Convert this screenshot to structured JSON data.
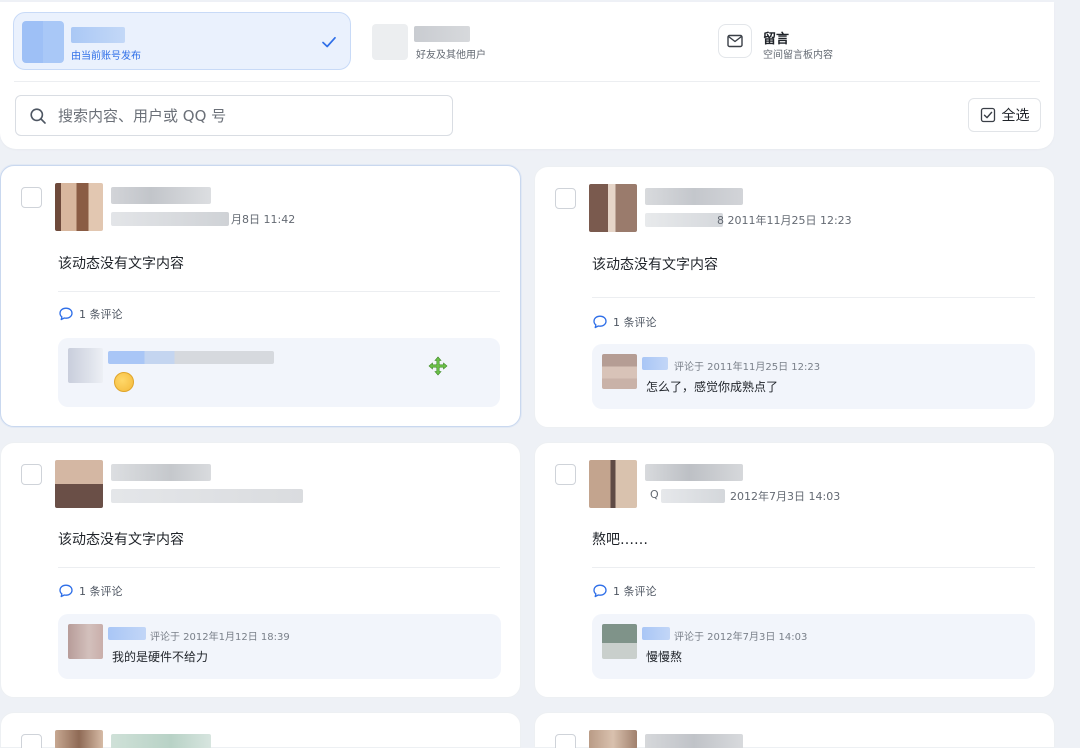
{
  "filters": {
    "mine": {
      "subtitle": "由当前账号发布"
    },
    "friends": {
      "subtitle": "好友及其他用户"
    },
    "guestbook": {
      "title": "留言",
      "subtitle": "空间留言板内容"
    }
  },
  "search": {
    "placeholder": "搜索内容、用户或 QQ 号",
    "value": ""
  },
  "toolbar": {
    "select_all_label": "全选"
  },
  "colors": {
    "accent": "#2f6fe8",
    "active_tab_bg": "#eaf1fd",
    "comment_bg": "#f2f5fb"
  },
  "posts": [
    {
      "date_fragment": "月8日 11:42",
      "text": "该动态没有文字内容",
      "comment_count": "1 条评论",
      "comment": {
        "emoji": "yawning-face"
      }
    },
    {
      "date_fragment": "8  2011年11月25日 12:23",
      "text": "该动态没有文字内容",
      "comment_count": "1 条评论",
      "comment": {
        "meta": "评论于  2011年11月25日 12:23",
        "text": "怎么了，感觉你成熟点了"
      }
    },
    {
      "text": "该动态没有文字内容",
      "comment_count": "1 条评论",
      "comment": {
        "meta": "评论于  2012年1月12日 18:39",
        "text": "我的是硬件不给力"
      }
    },
    {
      "date_prefix": "Q",
      "date_fragment": "2012年7月3日 14:03",
      "text": "熬吧……",
      "comment_count": "1 条评论",
      "comment": {
        "meta": "评论于  2012年7月3日 14:03",
        "text": "慢慢熬"
      }
    }
  ]
}
